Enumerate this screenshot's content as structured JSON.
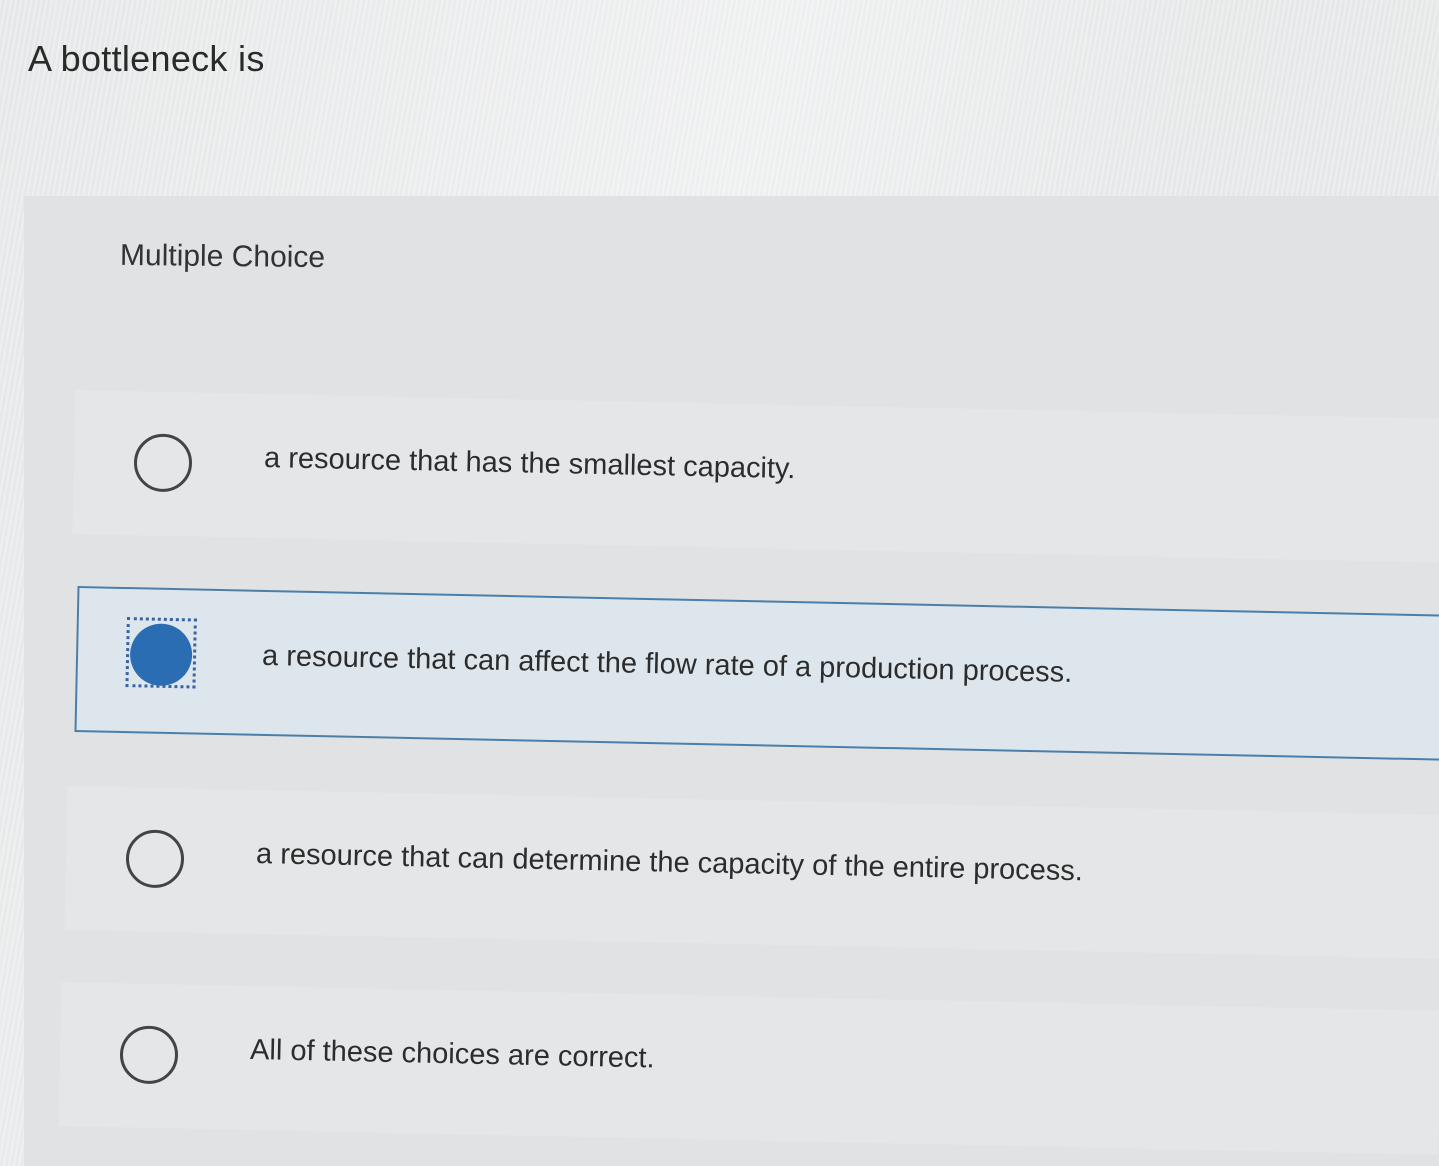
{
  "question": {
    "stem": "A bottleneck is"
  },
  "answer_block": {
    "heading": "Multiple Choice",
    "options": [
      {
        "label": "a resource that has the smallest capacity.",
        "selected": false
      },
      {
        "label": "a resource that can affect the flow rate of a production process.",
        "selected": true
      },
      {
        "label": "a resource that can determine the capacity of the entire process.",
        "selected": false
      },
      {
        "label": "All of these choices are correct.",
        "selected": false
      }
    ]
  },
  "colors": {
    "selected_radio": "#2a6db3",
    "selected_border": "#4b7fa9",
    "selected_background": "#dde6ec"
  }
}
